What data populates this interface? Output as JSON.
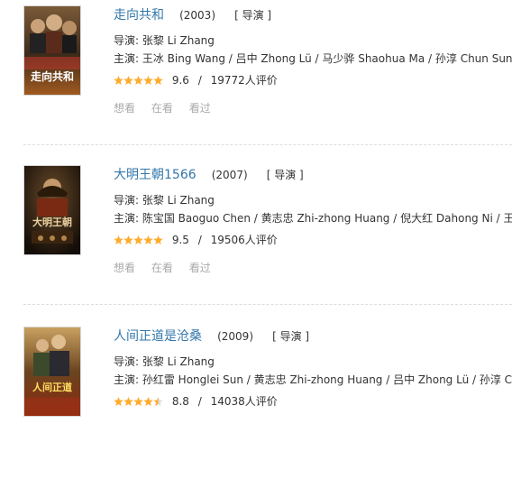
{
  "items": [
    {
      "title": "走向共和",
      "year": "(2003)",
      "role": "[ 导演 ]",
      "director": "导演: 张黎 Li Zhang",
      "cast": "主演: 王冰 Bing Wang / 吕中 Zhong Lü / 马少骅 Shaohua Ma / 孙淳 Chun Sun / 李...",
      "stars": 5,
      "score": "9.6",
      "votes": "19772人评价",
      "poster_text": "走向共和"
    },
    {
      "title": "大明王朝1566",
      "year": "(2007)",
      "role": "[ 导演 ]",
      "director": "导演: 张黎 Li Zhang",
      "cast": "主演: 陈宝国 Baoguo Chen / 黄志忠 Zhi-zhong Huang / 倪大红 Dahong Ni / 王庆祥 ...",
      "stars": 5,
      "score": "9.5",
      "votes": "19506人评价",
      "poster_text": "大明王朝"
    },
    {
      "title": "人间正道是沧桑",
      "year": "(2009)",
      "role": "[ 导演 ]",
      "director": "导演: 张黎 Li Zhang",
      "cast": "主演: 孙红雷 Honglei Sun / 黄志忠 Zhi-zhong Huang / 吕中 Zhong Lü / 孙淳 Chun...",
      "stars": 4.5,
      "score": "8.8",
      "votes": "14038人评价",
      "poster_text": "人间正道"
    }
  ],
  "slash": "/",
  "actions": {
    "want": "想看",
    "watching": "在看",
    "watched": "看过"
  },
  "colors": {
    "title_link": "#3377aa",
    "star": "#ffac2d",
    "star_empty": "#dddddd",
    "muted": "#aaaaaa"
  }
}
